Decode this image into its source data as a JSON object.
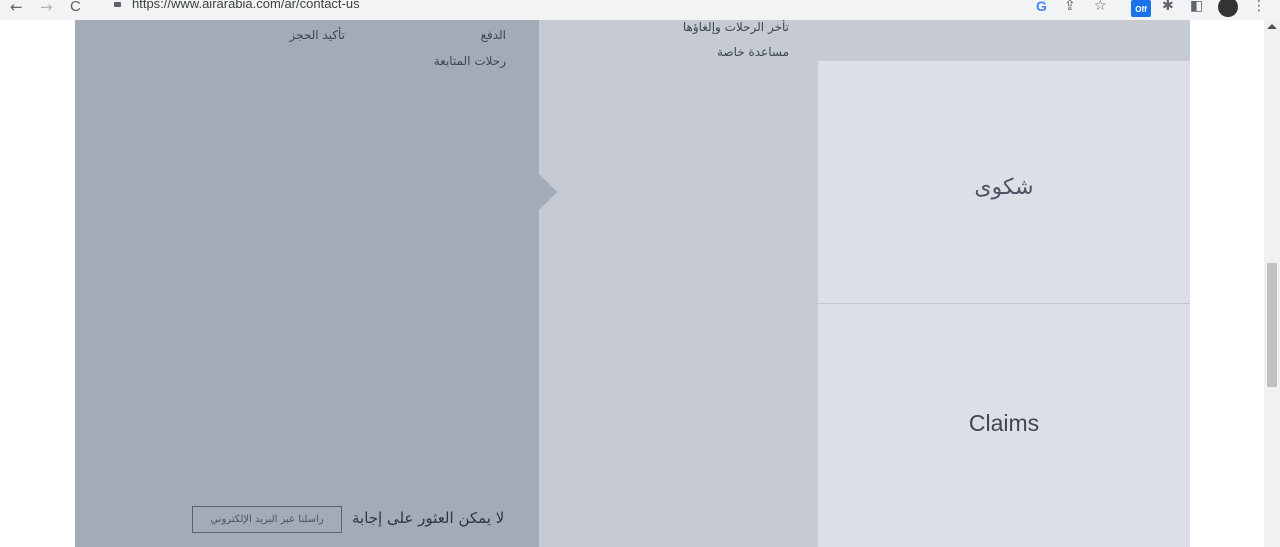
{
  "browser": {
    "url": "https://www.airarabia.com/ar/contact-us",
    "back_icon": "←",
    "forward_icon": "→",
    "reload_icon": "C",
    "google_icon": "G",
    "share_icon": "⇪",
    "star_icon": "☆",
    "ext_badge": "Off",
    "puzzle_icon": "✱",
    "window_icon": "◧",
    "menu_icon": "⋮"
  },
  "categories": {
    "col_left_links": [
      {
        "label": "الدفع"
      },
      {
        "label": "تأكيد الحجز"
      },
      {
        "label": "رحلات المتابعة"
      }
    ],
    "col_mid_links": [
      {
        "label": "تأخر الرحلات وإلغاؤها"
      },
      {
        "label": "مساعدة خاصة"
      }
    ]
  },
  "cards": {
    "complaint": {
      "label": "شكوى"
    },
    "claims": {
      "label": "Claims"
    }
  },
  "footer": {
    "not_found_text": "لا يمكن العثور على إجابة",
    "email_button": "راسلنا عبر البريد الإلكتروني"
  },
  "colors": {
    "panel_dark": "#a3abb6",
    "panel_mid": "#c5cad3",
    "card_bg": "#dcdfe6"
  }
}
